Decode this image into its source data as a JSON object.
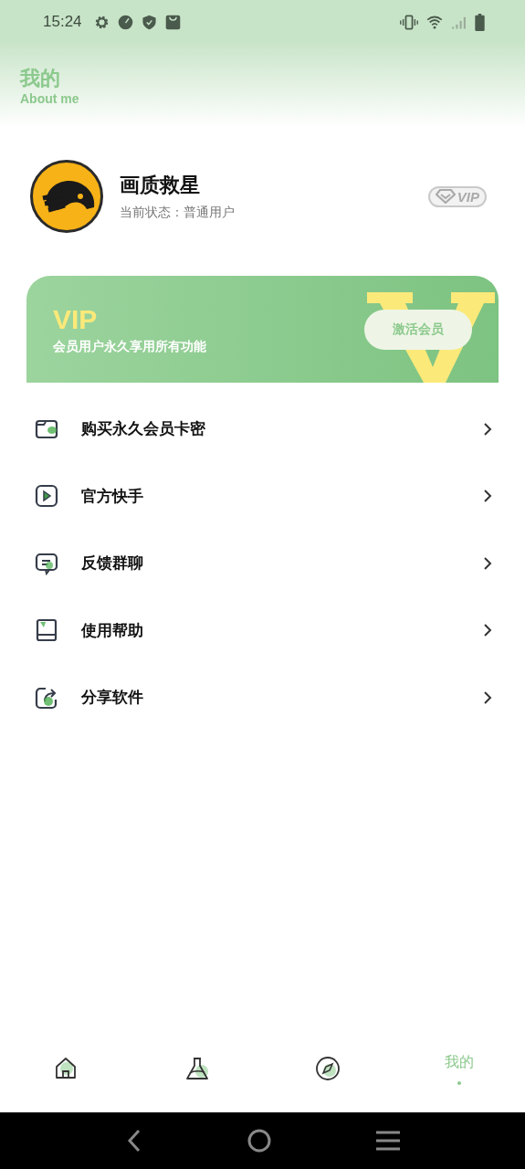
{
  "status_bar": {
    "time": "15:24"
  },
  "header": {
    "title": "我的",
    "subtitle": "About me"
  },
  "profile": {
    "name": "画质救星",
    "status": "当前状态：普通用户",
    "badge": "VIP",
    "vip": false
  },
  "banner": {
    "title": "VIP",
    "text": "会员用户永久享用所有功能",
    "button": "激活会员"
  },
  "menu": [
    {
      "kind": "wallet",
      "label": "购买永久会员卡密"
    },
    {
      "kind": "play",
      "label": "官方快手"
    },
    {
      "kind": "chat",
      "label": "反馈群聊"
    },
    {
      "kind": "book",
      "label": "使用帮助"
    },
    {
      "kind": "share",
      "label": "分享软件"
    }
  ],
  "tabs": [
    {
      "kind": "home",
      "selected": false
    },
    {
      "kind": "flask",
      "selected": false
    },
    {
      "kind": "compass",
      "selected": false
    },
    {
      "kind": "me",
      "label": "我的",
      "selected": true
    }
  ]
}
